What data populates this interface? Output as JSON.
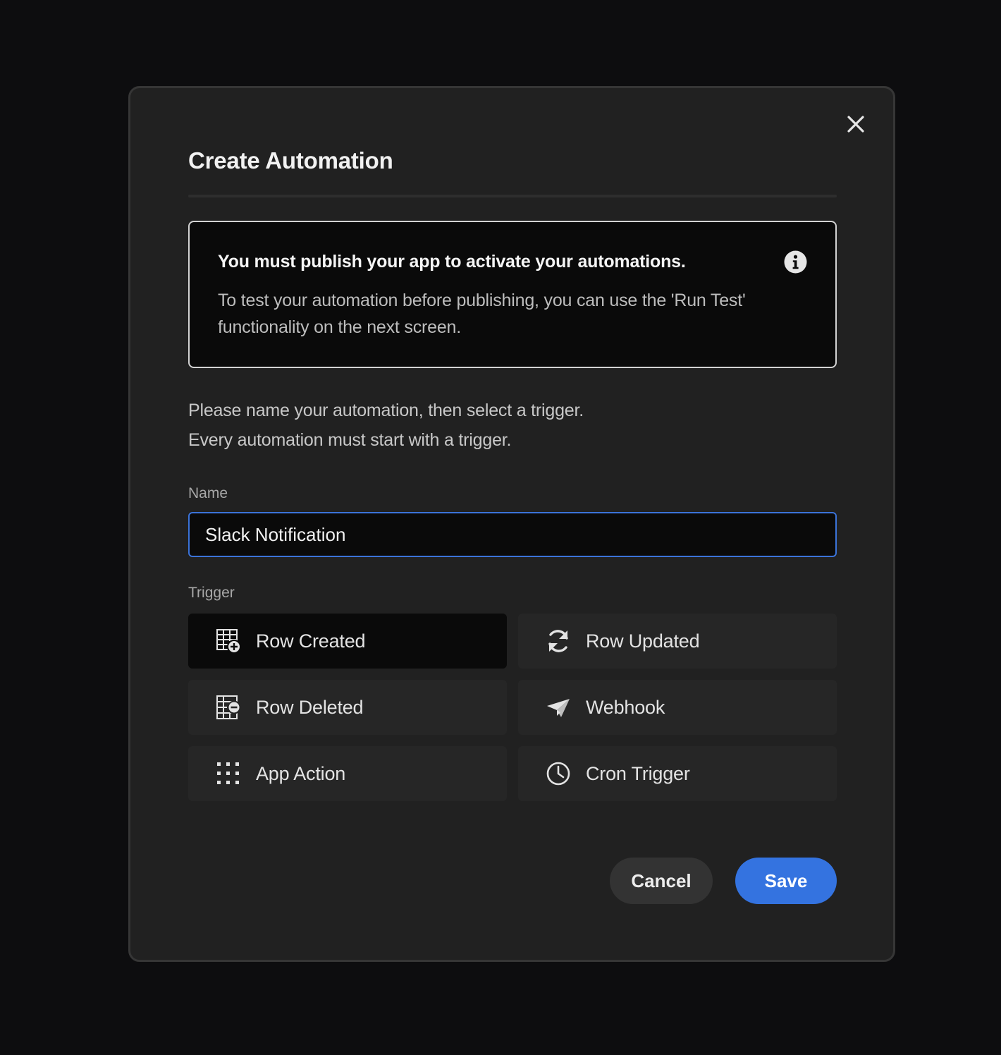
{
  "modal": {
    "title": "Create Automation",
    "close_icon": "close-icon"
  },
  "notice": {
    "title": "You must publish your app to activate your automations.",
    "body": "To test your automation before publishing, you can use the 'Run Test' functionality on the next screen.",
    "icon": "info-icon"
  },
  "intro": {
    "line1": "Please name your automation, then select a trigger.",
    "line2": "Every automation must start with a trigger."
  },
  "name_field": {
    "label": "Name",
    "value": "Slack Notification"
  },
  "trigger_field": {
    "label": "Trigger",
    "selected": "Row Created",
    "options": [
      {
        "label": "Row Created",
        "icon": "table-add-icon"
      },
      {
        "label": "Row Updated",
        "icon": "refresh-icon"
      },
      {
        "label": "Row Deleted",
        "icon": "table-remove-icon"
      },
      {
        "label": "Webhook",
        "icon": "send-icon"
      },
      {
        "label": "App Action",
        "icon": "grid-dots-icon"
      },
      {
        "label": "Cron Trigger",
        "icon": "clock-icon"
      }
    ]
  },
  "actions": {
    "cancel_label": "Cancel",
    "save_label": "Save"
  },
  "colors": {
    "accent": "#3473e0",
    "input_focus": "#3b73d8",
    "modal_bg": "#212121",
    "page_bg": "#0d0d0f"
  }
}
